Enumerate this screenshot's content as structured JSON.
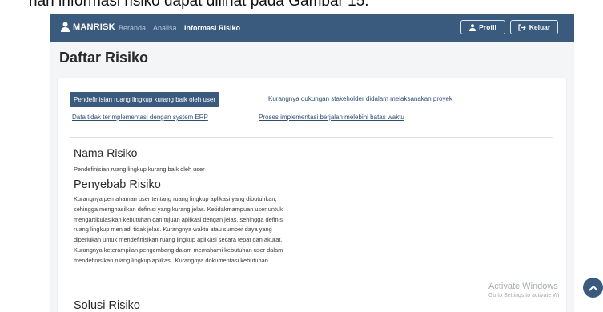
{
  "doc_caption": "han informasi risiko dapat dilihat pada Gambar 15.",
  "nav": {
    "brand": "MANRISK",
    "links": [
      "Beranda",
      "Analisa",
      "Informasi Risiko"
    ],
    "profile_label": "Profil",
    "logout_label": "Keluar"
  },
  "page_title": "Daftar Risiko",
  "tabs": [
    "Pendefinisian ruang lingkup kurang baik oleh user",
    "Kurangnya dukungan stakeholder didalam melaksanakan proyek",
    "Data tidak terimplementasi dengan system ERP",
    "Proses implementasi berjalan melebihi batas waktu"
  ],
  "detail": {
    "name_heading": "Nama Risiko",
    "name_value": "Pendefinisian ruang lingkup kurang baik oleh user",
    "cause_heading": "Penyebab Risiko",
    "cause_lines": [
      "Kurangnya pemahaman user tentang ruang lingkup aplikasi yang dibutuhkan,",
      "sehingga menghasilkan definisi yang kurang jelas. Ketidakmampuan user untuk",
      "mengartikulasikan kebutuhan dan tujuan aplikasi dengan jelas, sehingga definisi",
      "ruang lingkup menjadi tidak jelas. Kurangnya waktu atau sumber daya yang",
      "diperlukan untuk mendefinisikan ruang lingkup aplikasi secara tepat dan akurat.",
      "Kurangnya keterampilan pengembang dalam memahami kebutuhan user dalam",
      "mendefinisikan ruang lingkup aplikasi. Kurangnya dokumentasi kebutuhan"
    ],
    "solution_heading": "Solusi Risiko"
  },
  "watermark": {
    "title": "Activate Windows",
    "subtitle": "Go to Settings to activate Wi"
  },
  "colors": {
    "navbar": "#3a5a7e",
    "accent": "#3a5a7e",
    "link": "#2f4e70"
  },
  "icons": [
    "user-icon",
    "logout-icon",
    "chevron-up-icon"
  ]
}
